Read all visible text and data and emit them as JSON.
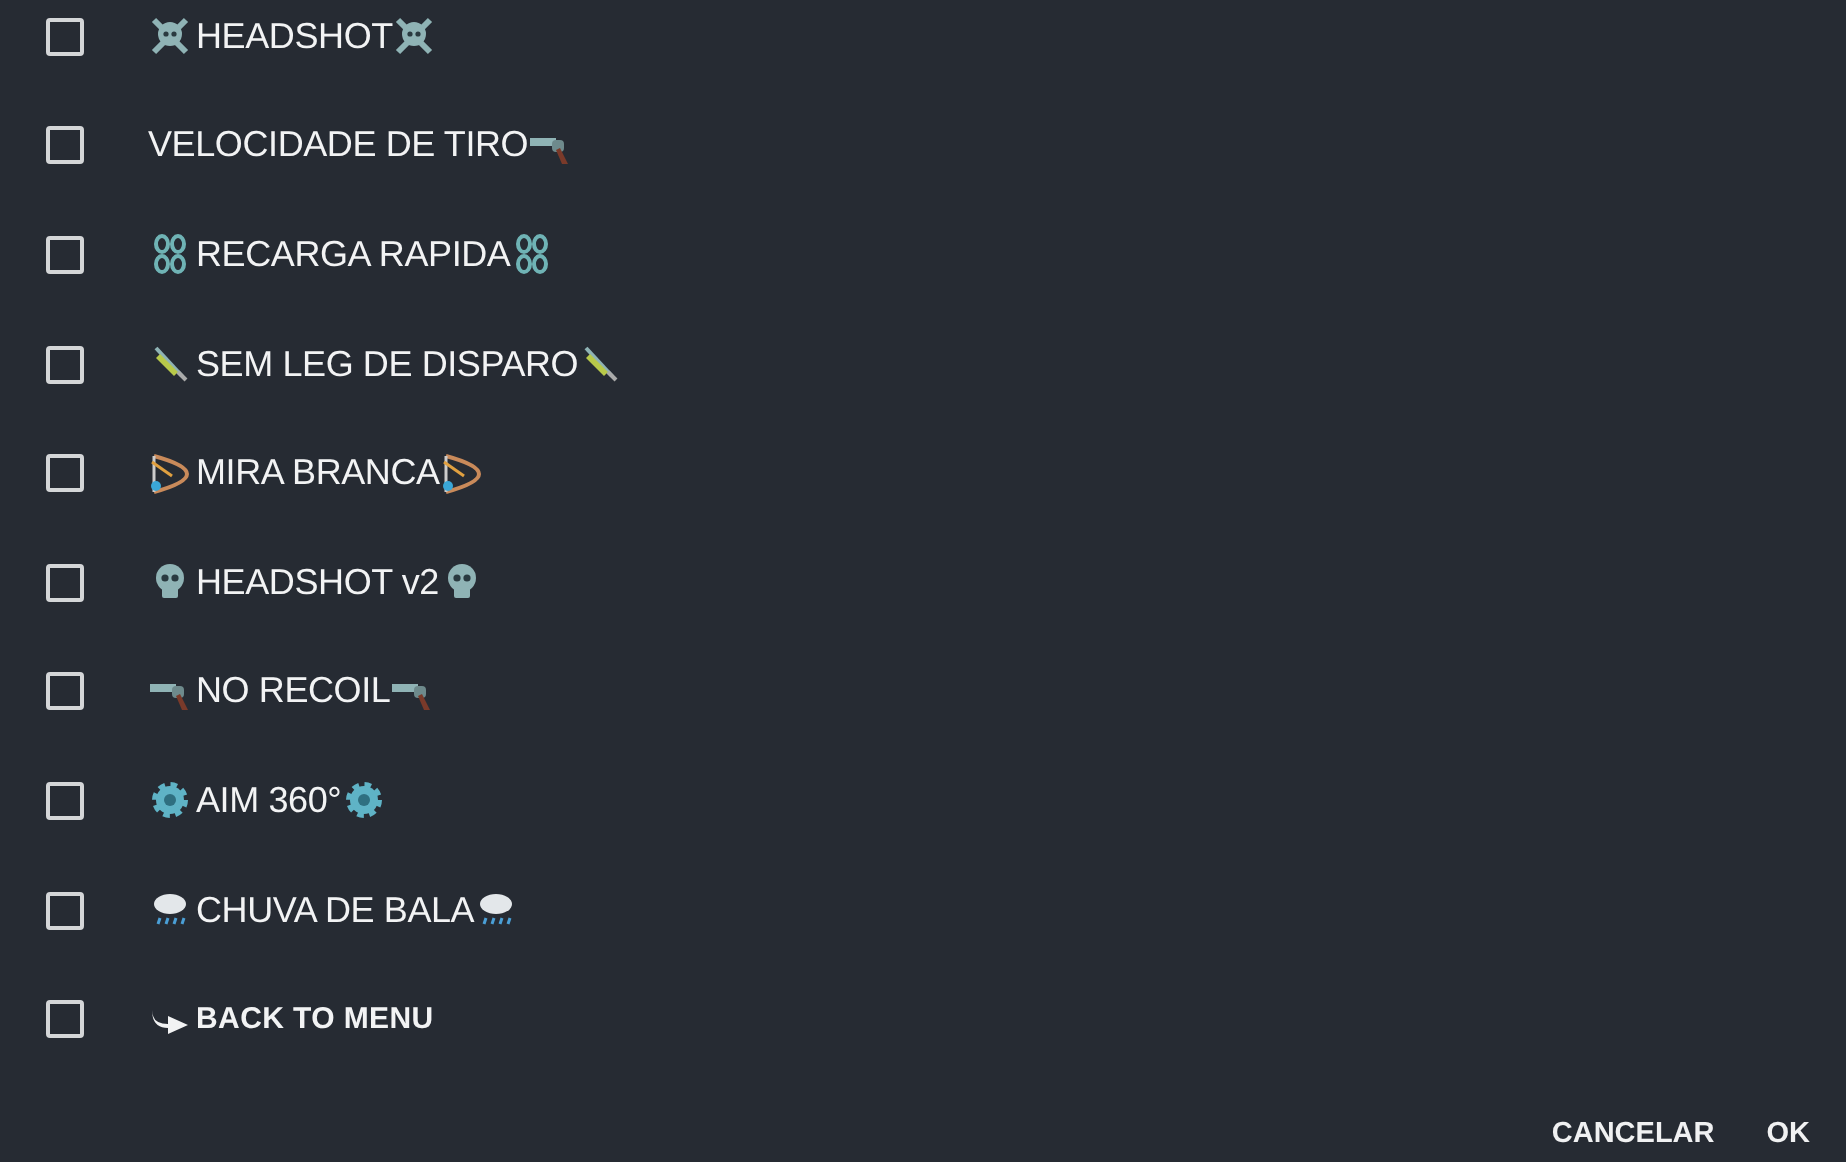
{
  "options": [
    {
      "label": "HEADSHOT",
      "kind": "crossbones",
      "checked": false
    },
    {
      "label": "VELOCIDADE DE TIRO",
      "kind": "gun-after",
      "checked": false
    },
    {
      "label": "RECARGA RAPIDA",
      "kind": "chains",
      "checked": false
    },
    {
      "label": "SEM LEG DE DISPARO",
      "kind": "syringe",
      "checked": false
    },
    {
      "label": "MIRA BRANCA",
      "kind": "bow",
      "checked": false
    },
    {
      "label": "HEADSHOT v2",
      "kind": "skull",
      "checked": false
    },
    {
      "label": "NO RECOIL",
      "kind": "gun",
      "checked": false
    },
    {
      "label": "AIM 360°",
      "kind": "gear",
      "checked": false
    },
    {
      "label": "CHUVA DE BALA",
      "kind": "rain",
      "checked": false
    },
    {
      "label": "BACK TO MENU",
      "kind": "back",
      "checked": false
    }
  ],
  "buttons": [
    "CANCELAR",
    "OK"
  ]
}
